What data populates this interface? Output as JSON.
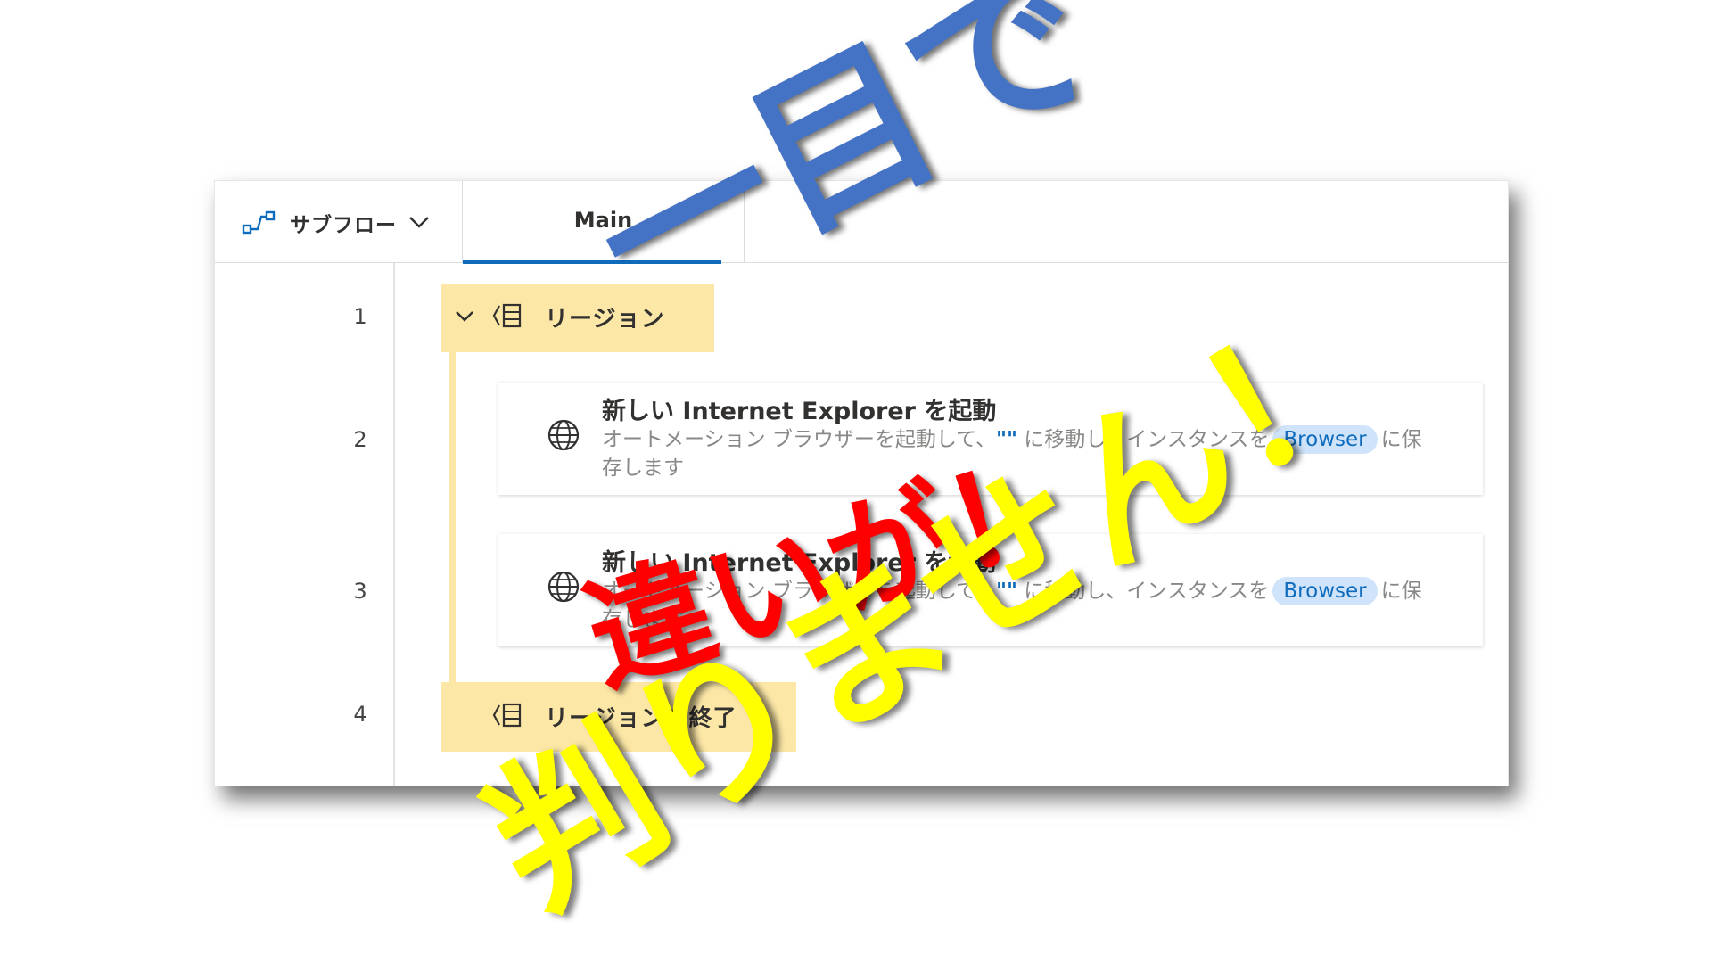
{
  "tabs": {
    "subflow_label": "サブフロー",
    "main_label": "Main"
  },
  "line_numbers": [
    "1",
    "2",
    "3",
    "4"
  ],
  "region": {
    "start_label": "リージョン",
    "end_label": "リージョンの終了"
  },
  "actions": [
    {
      "title": "新しい Internet Explorer を起動",
      "desc_prefix": "オートメーション ブラウザーを起動して、",
      "desc_quote": "\"\"",
      "desc_middle": " に移動し、インスタンスを",
      "variable": "Browser",
      "desc_suffix": "に保存します"
    },
    {
      "title": "新しい Internet Explorer を起動",
      "desc_prefix": "オートメーション ブラウザーを起動して、",
      "desc_quote": "\"\"",
      "desc_middle": " に移動し、インスタンスを",
      "variable": "Browser",
      "desc_suffix": "に保存します"
    }
  ],
  "overlay": {
    "line1": "一目で",
    "line2": "違いが！",
    "line3": "判りません！"
  },
  "colors": {
    "accent": "#0f6cbd",
    "region": "#fce7a6",
    "pill_bg": "#cfe4fa",
    "overlay_blue": "#4472c4",
    "overlay_red": "#ff0000",
    "overlay_yellow": "#ffff00"
  },
  "icons": {
    "subflow": "subflow-icon",
    "chevron": "chevron-down-icon",
    "region": "region-icon",
    "action": "globe-icon"
  }
}
